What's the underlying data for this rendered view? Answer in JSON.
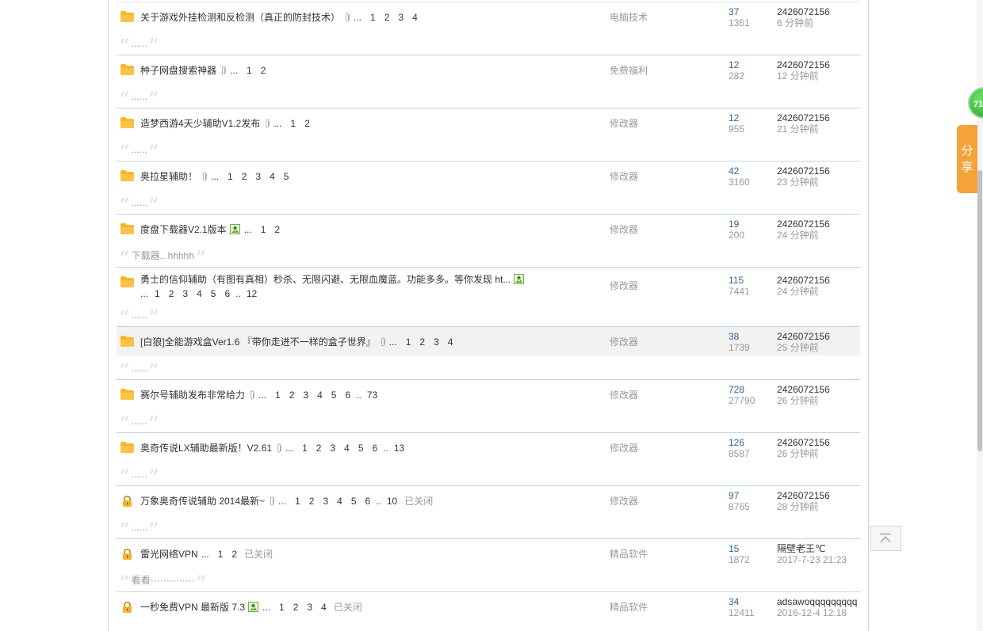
{
  "threads": [
    {
      "title": "关于游戏外挂检测和反检测（真正的防封技术）",
      "attach": "clip",
      "pages_line1": [
        "1",
        "2",
        "3",
        "4"
      ],
      "pages_line2": [],
      "closed": "",
      "forum": "电脑技术",
      "replies": "37",
      "views": "1361",
      "last_user": "2426072156",
      "last_time": "6 分钟前",
      "excerpt": "......",
      "icon": "folder"
    },
    {
      "title": "种子网盘搜索神器",
      "attach": "clip",
      "pages_line1": [
        "1",
        "2"
      ],
      "pages_line2": [],
      "closed": "",
      "forum": "免费福利",
      "replies": "12",
      "views": "282",
      "last_user": "2426072156",
      "last_time": "12 分钟前",
      "excerpt": "......",
      "icon": "folder"
    },
    {
      "title": "造梦西游4天少辅助V1.2发布",
      "attach": "clip",
      "pages_line1": [
        "1",
        "2"
      ],
      "pages_line2": [],
      "closed": "",
      "forum": "修改器",
      "replies": "12",
      "views": "955",
      "last_user": "2426072156",
      "last_time": "21 分钟前",
      "excerpt": "......",
      "icon": "folder"
    },
    {
      "title": "奥拉星辅助！",
      "attach": "clip",
      "pages_line1": [
        "1",
        "2",
        "3",
        "4",
        "5"
      ],
      "pages_line2": [],
      "closed": "",
      "forum": "修改器",
      "replies": "42",
      "views": "3160",
      "last_user": "2426072156",
      "last_time": "23 分钟前",
      "excerpt": "......",
      "icon": "folder"
    },
    {
      "title": "度盘下载器V2.1版本",
      "attach": "image",
      "pages_line1": [
        "1",
        "2"
      ],
      "pages_line2": [],
      "closed": "",
      "forum": "修改器",
      "replies": "19",
      "views": "200",
      "last_user": "2426072156",
      "last_time": "24 分钟前",
      "excerpt": "下载器...hhhhh",
      "icon": "folder"
    },
    {
      "title": "勇士的信仰辅助（有图有真相）秒杀、无限闪避、无限血魔蓝。功能多多。等你发现 ht...",
      "attach": "image",
      "pages_line1": [],
      "pages_line2": [
        "1",
        "2",
        "3",
        "4",
        "5",
        "6",
        "..",
        "12"
      ],
      "closed": "",
      "forum": "修改器",
      "replies": "115",
      "views": "7441",
      "last_user": "2426072156",
      "last_time": "24 分钟前",
      "excerpt": "......",
      "icon": "folder"
    },
    {
      "title": "[白狼]全能游戏盒Ver1.6 『带你走进不一样的盒子世界』",
      "attach": "clip",
      "pages_line1": [
        "1",
        "2",
        "3",
        "4"
      ],
      "pages_line2": [],
      "closed": "",
      "forum": "修改器",
      "replies": "38",
      "views": "1739",
      "last_user": "2426072156",
      "last_time": "25 分钟前",
      "excerpt": "......",
      "icon": "folder",
      "highlight": true
    },
    {
      "title": "赛尔号辅助发布非常给力",
      "attach": "clip",
      "pages_line1": [
        "1",
        "2",
        "3",
        "4",
        "5",
        "6",
        "..",
        "73"
      ],
      "pages_line2": [],
      "closed": "",
      "forum": "修改器",
      "replies": "728",
      "views": "27790",
      "last_user": "2426072156",
      "last_time": "26 分钟前",
      "excerpt": "......",
      "icon": "folder"
    },
    {
      "title": "奥奇传说LX辅助最新版！V2.61",
      "attach": "clip",
      "pages_line1": [
        "1",
        "2",
        "3",
        "4",
        "5",
        "6",
        "..",
        "13"
      ],
      "pages_line2": [],
      "closed": "",
      "forum": "修改器",
      "replies": "126",
      "views": "8587",
      "last_user": "2426072156",
      "last_time": "26 分钟前",
      "excerpt": "......",
      "icon": "folder"
    },
    {
      "title": "万象奥奇传说辅助 2014最新~",
      "attach": "clip",
      "pages_line1": [
        "1",
        "2",
        "3",
        "4",
        "5",
        "6",
        "..",
        "10"
      ],
      "pages_line2": [],
      "closed": "已关闭",
      "forum": "修改器",
      "replies": "97",
      "views": "8765",
      "last_user": "2426072156",
      "last_time": "28 分钟前",
      "excerpt": "......",
      "icon": "lock"
    },
    {
      "title": "雷光网络VPN",
      "attach": "",
      "pages_line1": [
        "1",
        "2"
      ],
      "pages_line2": [],
      "closed": "已关闭",
      "forum": "精品软件",
      "replies": "15",
      "views": "1872",
      "last_user": "隔壁老王℃",
      "last_time": "2017-7-23 21:23",
      "excerpt": "看看··············",
      "icon": "lock"
    },
    {
      "title": "一秒免费VPN 最新版 7.3",
      "attach": "image",
      "pages_line1": [
        "1",
        "2",
        "3",
        "4"
      ],
      "pages_line2": [],
      "closed": "已关闭",
      "forum": "精品软件",
      "replies": "34",
      "views": "12411",
      "last_user": "adsawoqqqqqqqqq",
      "last_time": "2016-12-4 12:18",
      "excerpt": "",
      "icon": "lock"
    }
  ],
  "ellipsis": "...",
  "badge": "71",
  "share": [
    "分",
    "享"
  ],
  "colors": {
    "folder": "#f9b52a",
    "divider": "#c2d5e3",
    "reply_count": "#336699",
    "share_bg": "#f4a23a"
  }
}
